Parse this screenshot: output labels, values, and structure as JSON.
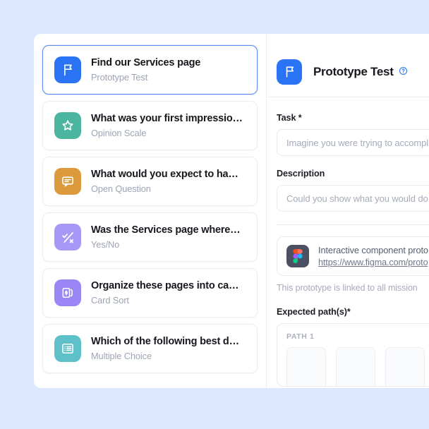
{
  "theme": {
    "page_background": "#dbe8fd",
    "panel_background": "#ffffff",
    "accent": "#2b73f5",
    "selected_border": "#5b8def"
  },
  "question_list": {
    "items": [
      {
        "title": "Find our Services page",
        "type": "Prototype Test",
        "icon": "flag-icon",
        "icon_color": "#2b73f5",
        "selected": true
      },
      {
        "title": "What was your first impressio…",
        "type": "Opinion Scale",
        "icon": "star-icon",
        "icon_color": "#4bb5a0",
        "selected": false
      },
      {
        "title": "What would you expect to ha…",
        "type": "Open Question",
        "icon": "speech-bubble-icon",
        "icon_color": "#dd9a3c",
        "selected": false
      },
      {
        "title": "Was the Services page where…",
        "type": "Yes/No",
        "icon": "check-cross-icon",
        "icon_color": "#a798f7",
        "selected": false
      },
      {
        "title": "Organize these pages into ca…",
        "type": "Card Sort",
        "icon": "card-sort-icon",
        "icon_color": "#9a86f5",
        "selected": false
      },
      {
        "title": "Which of the following best d…",
        "type": "Multiple Choice",
        "icon": "list-icon",
        "icon_color": "#5ec0c9",
        "selected": false
      }
    ]
  },
  "detail": {
    "header": {
      "title": "Prototype Test",
      "icon": "flag-icon",
      "icon_color": "#2b73f5",
      "help_icon": "help-circle-icon"
    },
    "task": {
      "label": "Task *",
      "placeholder": "Imagine you were trying to accompl"
    },
    "description": {
      "label": "Description",
      "placeholder": "Could you show what you would do"
    },
    "prototype": {
      "icon": "figma-icon",
      "name": "Interactive component proto",
      "url": "https://www.figma.com/proto",
      "note": "This prototype is linked to all mission"
    },
    "expected_paths": {
      "label": "Expected path(s)*",
      "path_label": "PATH 1",
      "thumbnails": [
        "",
        "",
        ""
      ]
    }
  }
}
